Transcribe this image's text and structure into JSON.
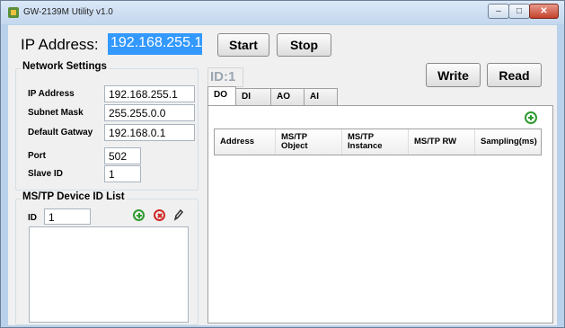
{
  "window": {
    "title": "GW-2139M Utility v1.0",
    "min": "–",
    "max": "□",
    "close": "✕"
  },
  "top": {
    "ip_label": "IP Address:",
    "ip_value": "192.168.255.1",
    "start": "Start",
    "stop": "Stop"
  },
  "network": {
    "title": "Network Settings",
    "fields": [
      {
        "label": "IP Address",
        "value": "192.168.255.1"
      },
      {
        "label": "Subnet Mask",
        "value": "255.255.0.0"
      },
      {
        "label": "Default Gatway",
        "value": "192.168.0.1"
      },
      {
        "label": "Port",
        "value": "502"
      },
      {
        "label": "Slave ID",
        "value": "1"
      }
    ]
  },
  "mstp": {
    "title": "MS/TP Device ID List",
    "id_label": "ID",
    "id_value": "1"
  },
  "device": {
    "badge": "ID:1",
    "write": "Write",
    "read": "Read"
  },
  "tabs": [
    "DO",
    "DI",
    "AO",
    "AI"
  ],
  "table": {
    "columns": [
      "Address",
      "MS/TP\nObject",
      "MS/TP\nInstance",
      "MS/TP RW",
      "Sampling(ms)"
    ]
  },
  "colors": {
    "titlebar": "#c3d7ee",
    "selection": "#3399ff",
    "add": "#2e9a2e",
    "delete": "#d02525"
  },
  "icons": {
    "add": "plus-circle-icon",
    "delete": "x-circle-icon",
    "edit": "pencil-icon"
  }
}
